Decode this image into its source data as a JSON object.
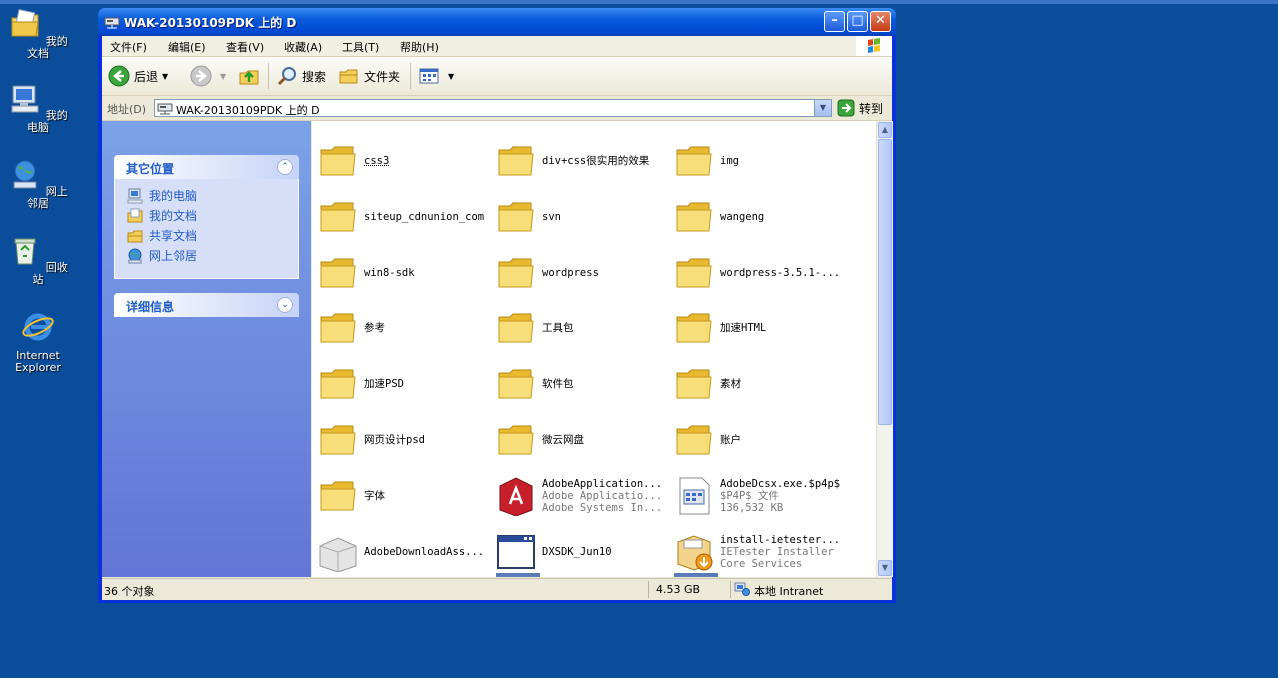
{
  "desktop": {
    "icons": [
      {
        "label": "我的文档",
        "icon": "my-documents-icon"
      },
      {
        "label": "我的电脑",
        "icon": "my-computer-icon"
      },
      {
        "label": "网上邻居",
        "icon": "network-places-icon"
      },
      {
        "label": "回收站",
        "icon": "recycle-bin-icon"
      },
      {
        "label": "Internet Explorer",
        "icon": "internet-explorer-icon"
      }
    ]
  },
  "window": {
    "title": "WAK-20130109PDK 上的 D",
    "menu": [
      "文件(F)",
      "编辑(E)",
      "查看(V)",
      "收藏(A)",
      "工具(T)",
      "帮助(H)"
    ],
    "toolbar": {
      "back": "后退",
      "search": "搜索",
      "folders": "文件夹"
    },
    "address": {
      "label": "地址(D)",
      "value": "WAK-20130109PDK 上的 D",
      "go": "转到"
    },
    "sidepanels": [
      {
        "title": "其它位置",
        "links": [
          "我的电脑",
          "我的文档",
          "共享文档",
          "网上邻居"
        ]
      },
      {
        "title": "详细信息"
      }
    ],
    "items": [
      {
        "name": "css3",
        "type": "folder"
      },
      {
        "name": "div+css很实用的效果",
        "type": "folder"
      },
      {
        "name": "img",
        "type": "folder"
      },
      {
        "name": "siteup_cdnunion_com",
        "type": "folder"
      },
      {
        "name": "svn",
        "type": "folder"
      },
      {
        "name": "wangeng",
        "type": "folder"
      },
      {
        "name": "win8-sdk",
        "type": "folder"
      },
      {
        "name": "wordpress",
        "type": "folder"
      },
      {
        "name": "wordpress-3.5.1-...",
        "type": "folder"
      },
      {
        "name": "参考",
        "type": "folder"
      },
      {
        "name": "工具包",
        "type": "folder"
      },
      {
        "name": "加速HTML",
        "type": "folder"
      },
      {
        "name": "加速PSD",
        "type": "folder"
      },
      {
        "name": "软件包",
        "type": "folder"
      },
      {
        "name": "素材",
        "type": "folder"
      },
      {
        "name": "网页设计psd",
        "type": "folder"
      },
      {
        "name": "微云网盘",
        "type": "folder"
      },
      {
        "name": "账户",
        "type": "folder"
      },
      {
        "name": "字体",
        "type": "folder"
      },
      {
        "name": "AdobeApplication...",
        "sub1": "Adobe Applicatio...",
        "sub2": "Adobe Systems In...",
        "type": "adobe"
      },
      {
        "name": "AdobeDcsx.exe.$p4p$",
        "sub1": "$P4P$ 文件",
        "sub2": "136,532 KB",
        "type": "file"
      },
      {
        "name": "AdobeDownloadAss...",
        "type": "box"
      },
      {
        "name": "DXSDK_Jun10",
        "type": "app"
      },
      {
        "name": "install-ietester...",
        "sub1": "IETester Installer",
        "sub2": "Core Services",
        "type": "installer"
      }
    ],
    "status": {
      "count": "36 个对象",
      "size": "4.53 GB",
      "zone": "本地 Intranet"
    }
  }
}
